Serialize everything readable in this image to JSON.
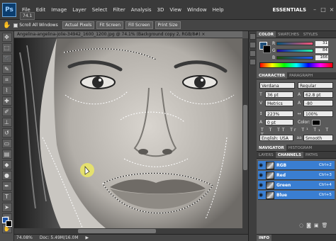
{
  "app": {
    "logo": "Ps",
    "menu": [
      "File",
      "Edit",
      "Image",
      "Layer",
      "Select",
      "Filter",
      "Analysis",
      "3D",
      "View",
      "Window",
      "Help"
    ],
    "zoom_level": "74.1",
    "workspace": "ESSENTIALS",
    "window_controls": [
      "–",
      "□",
      "×"
    ]
  },
  "options_bar": {
    "scroll_all_label": "Scroll All Windows",
    "buttons": [
      "Actual Pixels",
      "Fit Screen",
      "Fill Screen",
      "Print Size"
    ]
  },
  "document": {
    "tab_title": "Angelina-angelina-jolie-34942_1600_1200.jpg @ 74.1% (Background copy 2, RGB/8#) ×"
  },
  "status_bar": {
    "zoom": "74.08%",
    "doc": "Doc: 5.49M/16.0M"
  },
  "color_panel": {
    "tabs": [
      "COLOR",
      "SWATCHES",
      "STYLES"
    ],
    "channels": [
      {
        "label": "R",
        "value": "31",
        "gradient": "linear-gradient(to right,#004f7a,#ff4f7a)"
      },
      {
        "label": "G",
        "value": "84",
        "gradient": "linear-gradient(to right,#1f007a,#1fff7a)"
      },
      {
        "label": "B",
        "value": "166",
        "gradient": "linear-gradient(to right,#1f4f00,#1f4fff)"
      }
    ],
    "foreground": "#1f54a6"
  },
  "character_panel": {
    "tabs": [
      "CHARACTER",
      "PARAGRAPH"
    ],
    "font_family": "Verdana",
    "font_style": "Regular",
    "font_size": "36 pt",
    "leading": "62.8 pt",
    "kerning": "Metrics",
    "tracking": "-80",
    "vertical_scale": "223%",
    "horizontal_scale": "100%",
    "baseline_shift": "0 pt",
    "color_label": "Color:",
    "language": "English: USA",
    "antialias": "Smooth"
  },
  "navigator_panel": {
    "tabs": [
      "NAVIGATOR",
      "HISTOGRAM"
    ]
  },
  "layers_panel": {
    "tabs": [
      "LAYERS",
      "CHANNELS",
      "PATHS"
    ],
    "channels": [
      {
        "name": "RGB",
        "shortcut": "Ctrl+2"
      },
      {
        "name": "Red",
        "shortcut": "Ctrl+3"
      },
      {
        "name": "Green",
        "shortcut": "Ctrl+4"
      },
      {
        "name": "Blue",
        "shortcut": "Ctrl+5"
      }
    ]
  },
  "info_panel": {
    "tab": "INFO"
  }
}
